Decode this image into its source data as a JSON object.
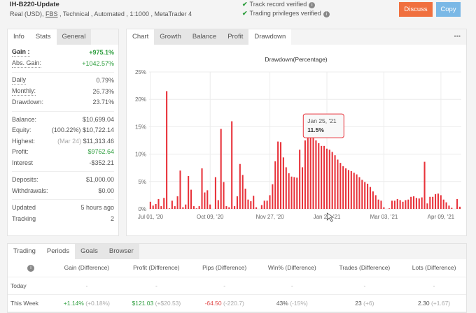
{
  "header": {
    "title": "IH-B220-Update",
    "subtitle_pre": "Real (USD), ",
    "broker": "FBS",
    "subtitle_post": " , Technical , Automated , 1:1000 , MetaTrader 4",
    "verified": [
      "Track record verified",
      "Trading privileges verified"
    ],
    "discuss": "Discuss",
    "copy": "Copy",
    "colors": {
      "discuss": "#f0703f",
      "copy": "#7ab8e6"
    }
  },
  "info": {
    "tabs": [
      "Info",
      "Stats",
      "General"
    ],
    "gain": [
      {
        "label": "Gain :",
        "value": "+975.1%"
      },
      {
        "label": "Abs. Gain:",
        "value": "+1042.57%"
      }
    ],
    "rates": [
      {
        "label": "Daily",
        "value": "0.79%"
      },
      {
        "label": "Monthly:",
        "value": "26.73%"
      },
      {
        "label": "Drawdown:",
        "value": "23.71%"
      }
    ],
    "balance": [
      {
        "label": "Balance:",
        "pre": "",
        "value": "$10,699.04"
      },
      {
        "label": "Equity:",
        "pre": "(100.22%)",
        "value": "$10,722.14"
      },
      {
        "label": "Highest:",
        "pre": "(Mar 24)",
        "value": "$11,313.46"
      },
      {
        "label": "Profit:",
        "pre": "",
        "value": "$9762.64"
      },
      {
        "label": "Interest",
        "pre": "",
        "value": "-$352.21"
      }
    ],
    "deposits": [
      {
        "label": "Deposits:",
        "value": "$1,000.00"
      },
      {
        "label": "Withdrawals:",
        "value": "$0.00"
      }
    ],
    "tracking": [
      {
        "label": "Updated",
        "value": "5 hours ago"
      },
      {
        "label": "Tracking",
        "value": "2"
      }
    ]
  },
  "chart_tabs": [
    "Chart",
    "Growth",
    "Balance",
    "Profit",
    "Drawdown"
  ],
  "more": "•••",
  "chart_data": {
    "type": "bar",
    "title": "Drawdown(Percentage)",
    "ylabel": "",
    "xlabel": "",
    "ylim": [
      0,
      25
    ],
    "yticks": [
      "0%",
      "5%",
      "10%",
      "15%",
      "20%",
      "25%"
    ],
    "xticks": [
      {
        "label": "Jul 01, '20",
        "index": 0
      },
      {
        "label": "Oct 09, '20",
        "index": 22
      },
      {
        "label": "Nov 27, '20",
        "index": 44
      },
      {
        "label": "Jan 27, '21",
        "index": 65
      },
      {
        "label": "Mar 03, '21",
        "index": 86
      },
      {
        "label": "Apr 09, '21",
        "index": 107
      }
    ],
    "color": "#e8333b",
    "values": [
      1.3,
      0.6,
      0.9,
      1.8,
      0.5,
      2.0,
      21.5,
      0.1,
      1.5,
      0.5,
      2.3,
      7.0,
      0.3,
      0.8,
      6.0,
      3.5,
      0.5,
      0.1,
      0.5,
      7.4,
      3.0,
      3.4,
      0.8,
      0,
      5.8,
      1.6,
      14.6,
      4.9,
      0.5,
      0.3,
      16.0,
      0.5,
      2.3,
      8.2,
      6.2,
      3.7,
      1.7,
      1.4,
      2.4,
      0.3,
      0,
      0.7,
      1.5,
      1.5,
      2.5,
      4.5,
      8.7,
      12.3,
      12.2,
      9.4,
      7.6,
      6.5,
      5.9,
      5.8,
      5.7,
      10.8,
      7.6,
      12.5,
      13,
      13.5,
      13,
      12.5,
      12,
      11.5,
      11.5,
      11,
      10.8,
      10.4,
      9.8,
      9,
      8.4,
      7.8,
      7.4,
      7.1,
      6.9,
      6.6,
      6.3,
      5.8,
      5.3,
      4.9,
      4.6,
      4.0,
      3.2,
      2.5,
      1.7,
      1.5,
      0.3,
      0,
      0.1,
      1.5,
      1.5,
      1.8,
      1.6,
      1.3,
      1.6,
      1.7,
      2.2,
      2.3,
      2.0,
      1.9,
      2.1,
      8.6,
      1.0,
      2.2,
      2.2,
      2.7,
      2.8,
      2.5,
      1.7,
      1.2,
      0.6,
      0.2,
      0,
      1.8,
      0.4
    ],
    "tooltip": {
      "index": 63,
      "date": "Jan 25, '21",
      "value": "11.5%"
    }
  },
  "periods": {
    "tabs": [
      "Trading",
      "Periods",
      "Goals",
      "Browser"
    ],
    "headers": [
      "Gain (Difference)",
      "Profit (Difference)",
      "Pips (Difference)",
      "Win% (Difference)",
      "Trades (Difference)",
      "Lots (Difference)"
    ],
    "rows": [
      {
        "label": "Today",
        "cells": [
          [
            "-",
            ""
          ],
          [
            "-",
            ""
          ],
          [
            "-",
            ""
          ],
          [
            "-",
            ""
          ],
          [
            "-",
            ""
          ],
          [
            "-",
            ""
          ]
        ]
      },
      {
        "label": "This Week",
        "cells": [
          [
            "+1.14%",
            "(+0.18%)"
          ],
          [
            "$121.03",
            "(+$20.53)"
          ],
          [
            "-64.50",
            "(-220.7)"
          ],
          [
            "43%",
            "(-15%)"
          ],
          [
            "23",
            "(+6)"
          ],
          [
            "2.30",
            "(+1.67)"
          ]
        ]
      }
    ]
  }
}
